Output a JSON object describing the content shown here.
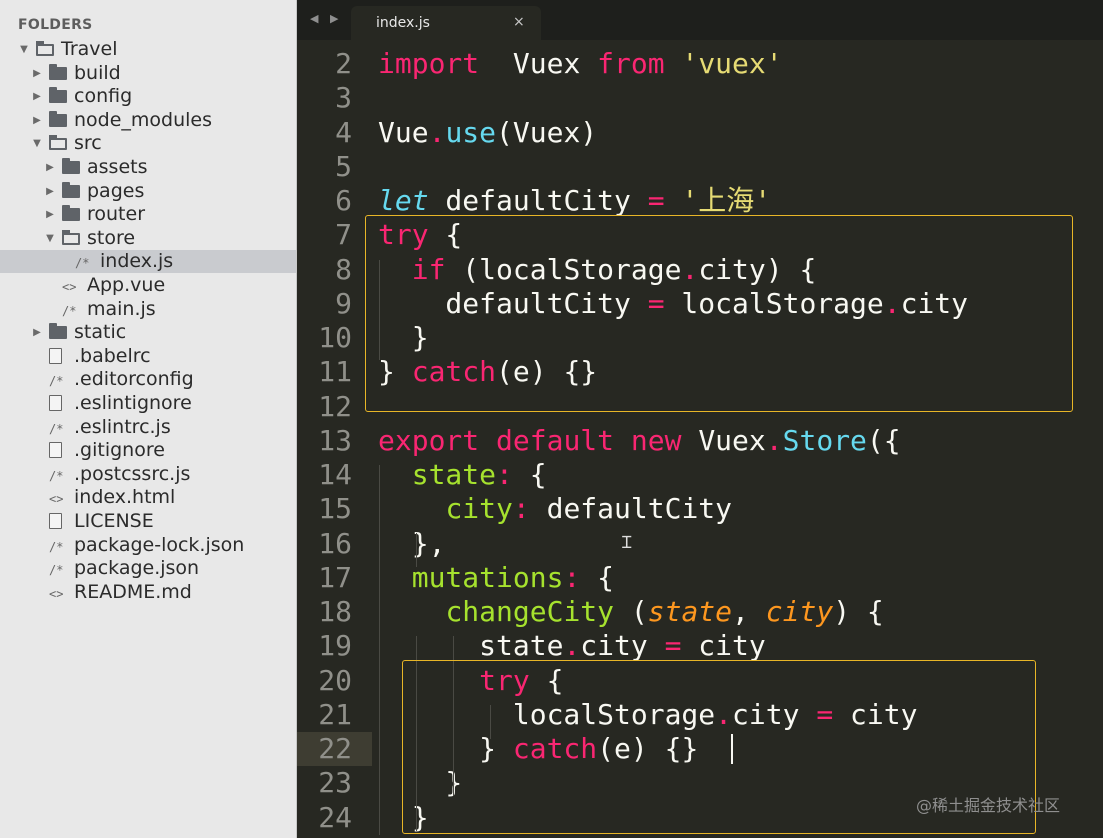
{
  "sidebar": {
    "title": "FOLDERS",
    "items": [
      {
        "label": "Travel",
        "type": "folder-open",
        "arrow": "▼"
      },
      {
        "label": "build",
        "type": "folder",
        "arrow": "▶"
      },
      {
        "label": "config",
        "type": "folder",
        "arrow": "▶"
      },
      {
        "label": "node_modules",
        "type": "folder",
        "arrow": "▶"
      },
      {
        "label": "src",
        "type": "folder-open",
        "arrow": "▼"
      },
      {
        "label": "assets",
        "type": "folder",
        "arrow": "▶"
      },
      {
        "label": "pages",
        "type": "folder",
        "arrow": "▶"
      },
      {
        "label": "router",
        "type": "folder",
        "arrow": "▶"
      },
      {
        "label": "store",
        "type": "folder-open",
        "arrow": "▼"
      },
      {
        "label": "index.js",
        "type": "code",
        "glyph": "/*",
        "selected": true
      },
      {
        "label": "App.vue",
        "type": "code",
        "glyph": "<>"
      },
      {
        "label": "main.js",
        "type": "code",
        "glyph": "/*"
      },
      {
        "label": "static",
        "type": "folder",
        "arrow": "▶"
      },
      {
        "label": ".babelrc",
        "type": "doc"
      },
      {
        "label": ".editorconfig",
        "type": "code",
        "glyph": "/*"
      },
      {
        "label": ".eslintignore",
        "type": "doc"
      },
      {
        "label": ".eslintrc.js",
        "type": "code",
        "glyph": "/*"
      },
      {
        "label": ".gitignore",
        "type": "doc"
      },
      {
        "label": ".postcssrc.js",
        "type": "code",
        "glyph": "/*"
      },
      {
        "label": "index.html",
        "type": "code",
        "glyph": "<>"
      },
      {
        "label": "LICENSE",
        "type": "doc"
      },
      {
        "label": "package-lock.json",
        "type": "code",
        "glyph": "/*"
      },
      {
        "label": "package.json",
        "type": "code",
        "glyph": "/*"
      },
      {
        "label": "README.md",
        "type": "code",
        "glyph": "<>"
      }
    ]
  },
  "tabbar": {
    "nav": "◀ ▶",
    "active_tab": "index.js",
    "close": "×"
  },
  "editor": {
    "current_line": 22,
    "lines": [
      {
        "n": "2",
        "tokens": [
          [
            "kw",
            "import"
          ],
          [
            "",
            "  Vuex "
          ],
          [
            "kw",
            "from"
          ],
          [
            "",
            " "
          ],
          [
            "str",
            "'vuex'"
          ]
        ]
      },
      {
        "n": "3",
        "tokens": []
      },
      {
        "n": "4",
        "tokens": [
          [
            "",
            "Vue"
          ],
          [
            "kw",
            "."
          ],
          [
            "bi",
            "use"
          ],
          [
            "",
            "(Vuex)"
          ]
        ]
      },
      {
        "n": "5",
        "tokens": []
      },
      {
        "n": "6",
        "tokens": [
          [
            "sto",
            "let"
          ],
          [
            "",
            " defaultCity "
          ],
          [
            "kw",
            "="
          ],
          [
            "",
            " "
          ],
          [
            "str",
            "'上海'"
          ]
        ]
      },
      {
        "n": "7",
        "tokens": [
          [
            "kw",
            "try"
          ],
          [
            "",
            " {"
          ]
        ]
      },
      {
        "n": "8",
        "tokens": [
          [
            "",
            "  "
          ],
          [
            "kw",
            "if"
          ],
          [
            "",
            " (localStorage"
          ],
          [
            "kw",
            "."
          ],
          [
            "",
            "city) {"
          ]
        ]
      },
      {
        "n": "9",
        "tokens": [
          [
            "",
            "    defaultCity "
          ],
          [
            "kw",
            "="
          ],
          [
            "",
            " localStorage"
          ],
          [
            "kw",
            "."
          ],
          [
            "",
            "city"
          ]
        ]
      },
      {
        "n": "10",
        "tokens": [
          [
            "",
            "  }"
          ]
        ]
      },
      {
        "n": "11",
        "tokens": [
          [
            "",
            "} "
          ],
          [
            "kw",
            "catch"
          ],
          [
            "",
            "(e) {}"
          ]
        ]
      },
      {
        "n": "12",
        "tokens": []
      },
      {
        "n": "13",
        "tokens": [
          [
            "kw",
            "export"
          ],
          [
            "",
            " "
          ],
          [
            "kw",
            "default"
          ],
          [
            "",
            " "
          ],
          [
            "kw",
            "new"
          ],
          [
            "",
            " Vuex"
          ],
          [
            "kw",
            "."
          ],
          [
            "bi",
            "Store"
          ],
          [
            "",
            "({"
          ]
        ]
      },
      {
        "n": "14",
        "tokens": [
          [
            "",
            "  "
          ],
          [
            "fn",
            "state"
          ],
          [
            "kw",
            ":"
          ],
          [
            "",
            " {"
          ]
        ]
      },
      {
        "n": "15",
        "tokens": [
          [
            "",
            "    "
          ],
          [
            "fn",
            "city"
          ],
          [
            "kw",
            ":"
          ],
          [
            "",
            " defaultCity"
          ]
        ]
      },
      {
        "n": "16",
        "tokens": [
          [
            "",
            "  },"
          ]
        ]
      },
      {
        "n": "17",
        "tokens": [
          [
            "",
            "  "
          ],
          [
            "fn",
            "mutations"
          ],
          [
            "kw",
            ":"
          ],
          [
            "",
            " {"
          ]
        ]
      },
      {
        "n": "18",
        "tokens": [
          [
            "",
            "    "
          ],
          [
            "fn",
            "changeCity"
          ],
          [
            "",
            " ("
          ],
          [
            "prm",
            "state"
          ],
          [
            "",
            ", "
          ],
          [
            "prm",
            "city"
          ],
          [
            "",
            ") {"
          ]
        ]
      },
      {
        "n": "19",
        "tokens": [
          [
            "",
            "      state"
          ],
          [
            "kw",
            "."
          ],
          [
            "",
            "city "
          ],
          [
            "kw",
            "="
          ],
          [
            "",
            " city"
          ]
        ]
      },
      {
        "n": "20",
        "tokens": [
          [
            "",
            "      "
          ],
          [
            "kw",
            "try"
          ],
          [
            "",
            " {"
          ]
        ]
      },
      {
        "n": "21",
        "tokens": [
          [
            "",
            "        localStorage"
          ],
          [
            "kw",
            "."
          ],
          [
            "",
            "city "
          ],
          [
            "kw",
            "="
          ],
          [
            "",
            " city"
          ]
        ]
      },
      {
        "n": "22",
        "tokens": [
          [
            "",
            "      } "
          ],
          [
            "kw",
            "catch"
          ],
          [
            "",
            "(e) {}"
          ]
        ]
      },
      {
        "n": "23",
        "tokens": [
          [
            "",
            "    }"
          ]
        ]
      },
      {
        "n": "24",
        "tokens": [
          [
            "",
            "  }"
          ]
        ]
      }
    ]
  },
  "watermark": "@稀土掘金技术社区",
  "colors": {
    "background": "#272822",
    "keyword": "#f92672",
    "function": "#a6e22e",
    "string": "#e6db74",
    "builtin": "#66d9ef",
    "param": "#fd971f",
    "highlight_box": "#e8b627"
  }
}
